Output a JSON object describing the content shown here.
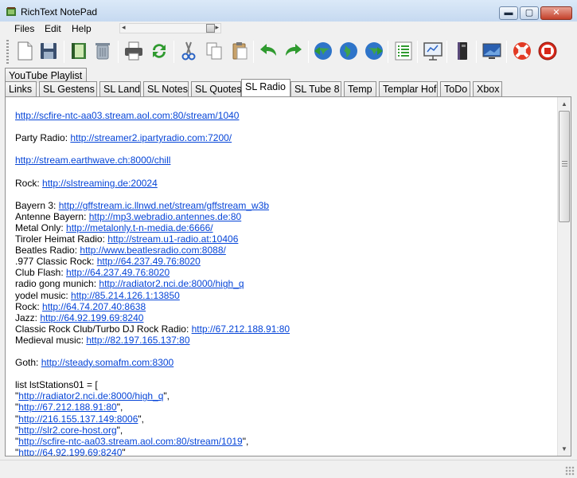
{
  "window": {
    "title": "RichText NotePad"
  },
  "menu": {
    "files": "Files",
    "edit": "Edit",
    "help": "Help"
  },
  "toolbar": {
    "buttons": [
      "new-document",
      "save",
      "open-book",
      "trash",
      "print",
      "refresh",
      "cut",
      "copy",
      "paste",
      "undo",
      "redo",
      "globe-back",
      "globe",
      "globe-forward",
      "list",
      "presentation",
      "book",
      "monitor",
      "help-lifebuoy",
      "stop"
    ]
  },
  "tabs": {
    "row1": [
      "YouTube Playlist"
    ],
    "row2": [
      "Links",
      "SL Gestens",
      "SL Land",
      "SL Notes",
      "SL Quotes",
      "SL Radio",
      "SL Tube 8",
      "Temp",
      "Templar Hof",
      "ToDo",
      "Xbox"
    ],
    "active": "SL Radio"
  },
  "editor": {
    "lines": [
      {
        "text": "",
        "link": "http://scfire-ntc-aa03.stream.aol.com:80/stream/1040",
        "after": ""
      },
      {
        "text": "",
        "link": "",
        "after": ""
      },
      {
        "text": "Party Radio: ",
        "link": "http://streamer2.ipartyradio.com:7200/",
        "after": ""
      },
      {
        "text": "",
        "link": "",
        "after": ""
      },
      {
        "text": "",
        "link": "http://stream.earthwave.ch:8000/chill",
        "after": ""
      },
      {
        "text": "",
        "link": "",
        "after": ""
      },
      {
        "text": "Rock: ",
        "link": "http://slstreaming.de:20024",
        "after": ""
      },
      {
        "text": "",
        "link": "",
        "after": ""
      },
      {
        "text": "Bayern 3: ",
        "link": "http://gffstream.ic.llnwd.net/stream/gffstream_w3b",
        "after": ""
      },
      {
        "text": "Antenne Bayern: ",
        "link": "http://mp3.webradio.antennes.de:80",
        "after": ""
      },
      {
        "text": "Metal Only: ",
        "link": "http://metalonly.t-n-media.de:6666/",
        "after": ""
      },
      {
        "text": "Tiroler Heimat Radio: ",
        "link": "http://stream.u1-radio.at:10406",
        "after": ""
      },
      {
        "text": "Beatles Radio: ",
        "link": "http://www.beatlesradio.com:8088/",
        "after": ""
      },
      {
        "text": ".977 Classic Rock: ",
        "link": "http://64.237.49.76:8020",
        "after": ""
      },
      {
        "text": "Club Flash: ",
        "link": "http://64.237.49.76:8020",
        "after": ""
      },
      {
        "text": "radio gong munich: ",
        "link": "http://radiator2.nci.de:8000/high_q",
        "after": ""
      },
      {
        "text": "yodel music: ",
        "link": "http://85.214.126.1:13850",
        "after": ""
      },
      {
        "text": "Rock: ",
        "link": "http://64.74.207.40:8638",
        "after": ""
      },
      {
        "text": "Jazz: ",
        "link": "http://64.92.199.69:8240",
        "after": ""
      },
      {
        "text": "Classic Rock Club/Turbo DJ Rock Radio: ",
        "link": "http://67.212.188.91:80",
        "after": ""
      },
      {
        "text": "Medieval music: ",
        "link": "http://82.197.165.137:80",
        "after": ""
      },
      {
        "text": "",
        "link": "",
        "after": ""
      },
      {
        "text": "Goth: ",
        "link": "http://steady.somafm.com:8300",
        "after": ""
      },
      {
        "text": "",
        "link": "",
        "after": ""
      },
      {
        "text": "  list lstStations01  = [",
        "link": "",
        "after": ""
      },
      {
        "text": "\"",
        "link": "http://radiator2.nci.de:8000/high_q",
        "after": "\","
      },
      {
        "text": "\"",
        "link": "http://67.212.188.91:80",
        "after": "\","
      },
      {
        "text": "\"",
        "link": "http://216.155.137.149:8006",
        "after": "\","
      },
      {
        "text": "\"",
        "link": "http://slr2.core-host.org",
        "after": "\","
      },
      {
        "text": "\"",
        "link": "http://scfire-ntc-aa03.stream.aol.com:80/stream/1019",
        "after": "\","
      },
      {
        "text": "\"",
        "link": "http://64.92.199.69:8240",
        "after": "\""
      }
    ]
  }
}
